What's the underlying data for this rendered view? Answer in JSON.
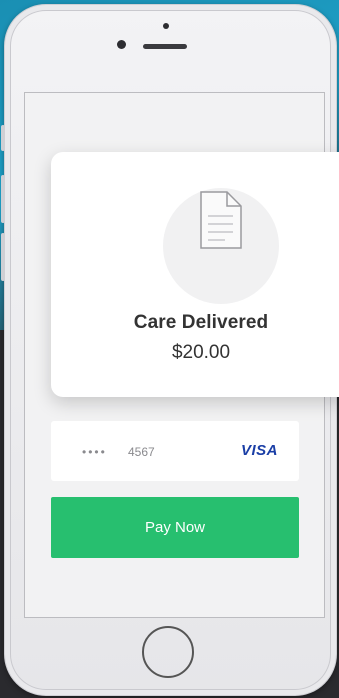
{
  "receipt": {
    "title": "Care Delivered",
    "amount": "$20.00",
    "icon": "document-icon"
  },
  "payment_method": {
    "masked": "•••• ",
    "last4": "4567",
    "brand": "VISA"
  },
  "pay_button": {
    "label": "Pay Now",
    "color": "#27bf6f"
  },
  "colors": {
    "accent": "#27bf6f",
    "visa_blue": "#1a3ea6"
  }
}
